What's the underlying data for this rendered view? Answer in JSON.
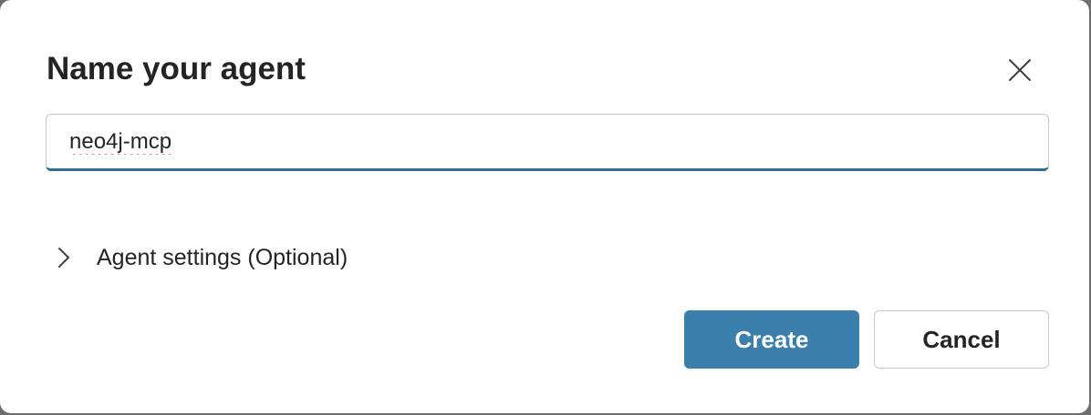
{
  "dialog": {
    "title": "Name your agent",
    "close_icon": "close-icon"
  },
  "name_field": {
    "value": "neo4j-mcp",
    "spellcheck_error": true
  },
  "settings": {
    "label": "Agent settings (Optional)",
    "icon": "chevron-right-icon",
    "expanded": false
  },
  "actions": {
    "create_label": "Create",
    "cancel_label": "Cancel"
  },
  "colors": {
    "primary": "#3b7fac",
    "input_focus_border": "#2f6e97",
    "text": "#242424",
    "spellcheck_underline": "#d13438"
  }
}
